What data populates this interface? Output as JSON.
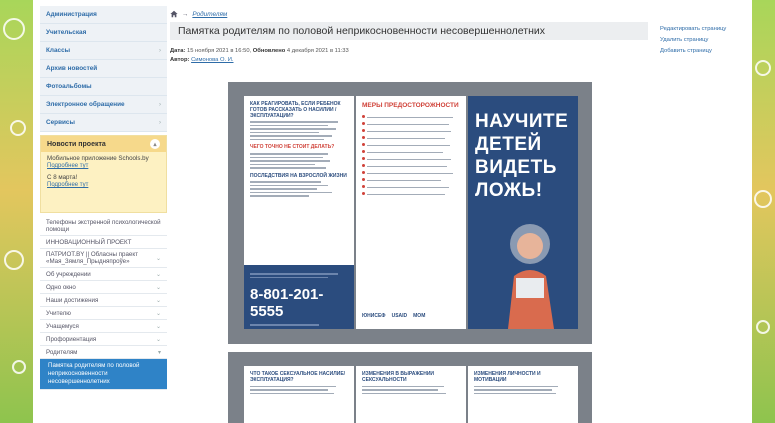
{
  "sidebar": {
    "menu": [
      {
        "label": "Администрация",
        "arrow": ""
      },
      {
        "label": "Учительская",
        "arrow": ""
      },
      {
        "label": "Классы",
        "arrow": "›"
      },
      {
        "label": "Архив новостей",
        "arrow": ""
      },
      {
        "label": "Фотоальбомы",
        "arrow": ""
      },
      {
        "label": "Электронное обращение",
        "arrow": "›"
      },
      {
        "label": "Сервисы",
        "arrow": "›"
      }
    ],
    "news": {
      "title": "Новости проекта",
      "toggle": "▴",
      "items": [
        {
          "text": "Мобильное приложение Schools.by",
          "link": "Подробнее тут"
        },
        {
          "text": "С 8 марта!",
          "link": "Подробнее тут"
        }
      ]
    },
    "menu2": [
      {
        "label": "Телефоны экстренной психологической помощи",
        "arrow": ""
      },
      {
        "label": "ИННОВАЦИОННЫЙ ПРОЕКТ",
        "arrow": ""
      },
      {
        "label": "ПАТРИОТ.BY || Обласны праект «Мая_Зямля_Прыдняпроўе»",
        "arrow": "⌄"
      },
      {
        "label": "Об учреждении",
        "arrow": "⌄"
      },
      {
        "label": "Одно окно",
        "arrow": "⌄"
      },
      {
        "label": "Наши достижения",
        "arrow": "⌄"
      },
      {
        "label": "Учителю",
        "arrow": "⌄"
      },
      {
        "label": "Учащемуся",
        "arrow": "⌄"
      },
      {
        "label": "Профориентация",
        "arrow": "⌄"
      },
      {
        "label": "Родителям",
        "arrow": "▾"
      }
    ],
    "active_item": "Памятка родителям по половой неприкосновенности несовершеннолетних"
  },
  "breadcrumb": {
    "home_icon": "home-icon",
    "arrow": "→",
    "link": "Родителям"
  },
  "page": {
    "title": "Памятка родителям по половой неприкосновенности несовершеннолетних",
    "date_label": "Дата:",
    "date": "15 ноября 2021 в 16:50,",
    "updated_label": "Обновлено",
    "updated": "4 декабря 2021 в 11:33",
    "author_label": "Автор:",
    "author": "Симонова О. И."
  },
  "actions": [
    "Редактировать страницу",
    "Удалить страницу",
    "Добавить страницу"
  ],
  "poster": {
    "headline_lines": [
      "НАУЧИТЕ",
      "ДЕТЕЙ",
      "ВИДЕТЬ",
      "ЛОЖЬ!"
    ],
    "section_caution": "МЕРЫ ПРЕДОСТОРОЖНОСТИ",
    "section_how": "КАК РЕАГИРОВАТЬ, ЕСЛИ РЕБЕНОК ГОТОВ РАССКАЗАТЬ О НАСИЛИИ / ЭКСПЛУАТАЦИИ?",
    "section_not": "ЧЕГО ТОЧНО НЕ СТОИТ ДЕЛАТЬ?",
    "section_consequences": "ПОСЛЕДСТВИЯ НА ВЗРОСЛОЙ ЖИЗНИ",
    "phone": "8-801-201-5555",
    "page2_sections": [
      "ЧТО ТАКОЕ СЕКСУАЛЬНОЕ НАСИЛИЕ/ЭКСПЛУАТАЦИЯ?",
      "ИЗМЕНЕНИЯ В ВЫРАЖЕНИИ СЕКСУАЛЬНОСТИ",
      "ИЗМЕНЕНИЯ ЛИЧНОСТИ И МОТИВАЦИИ"
    ],
    "logos": [
      "ЮНИСЕФ",
      "USAID",
      "МОМ"
    ]
  },
  "colors": {
    "accent": "#2f83c7",
    "poster_blue": "#2b4c7e",
    "poster_red": "#d0433a",
    "news_bg": "#fdf1c2"
  }
}
